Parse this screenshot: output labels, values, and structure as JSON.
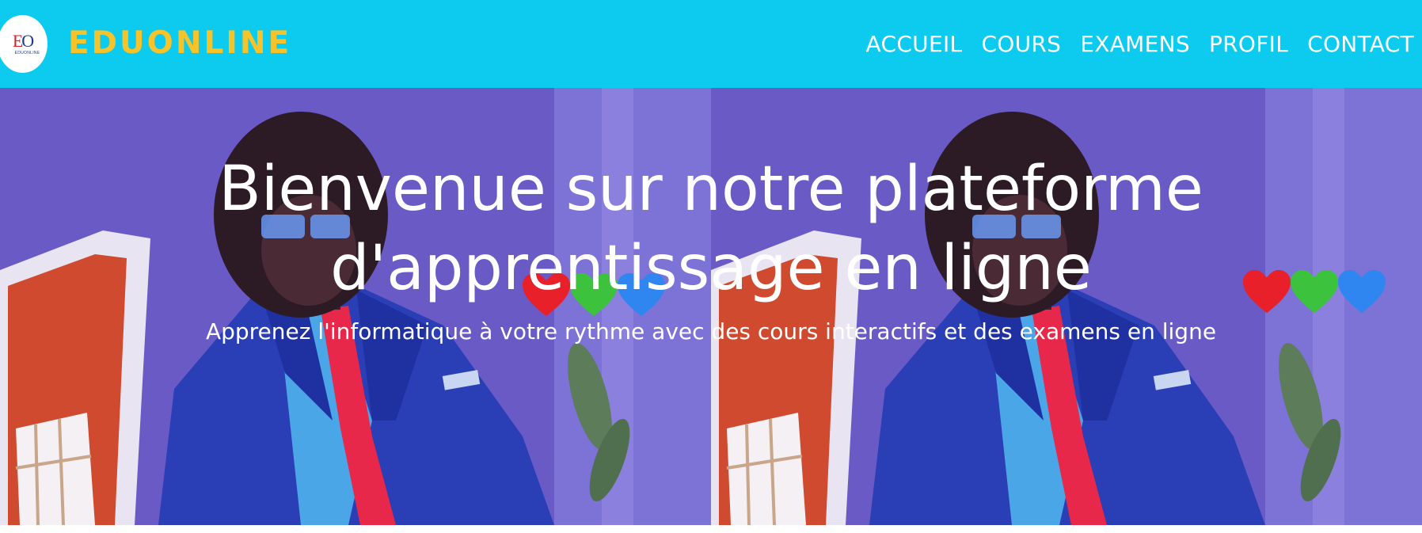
{
  "header": {
    "logo_mark_e": "E",
    "logo_mark_o": "O",
    "logo_sub": "EDUONLINE",
    "brand": "EDUONLINE",
    "nav": [
      {
        "label": "ACCUEIL"
      },
      {
        "label": "COURS"
      },
      {
        "label": "EXAMENS"
      },
      {
        "label": "PROFIL"
      },
      {
        "label": "CONTACT"
      }
    ]
  },
  "hero": {
    "title": "Bienvenue sur notre plateforme d'apprentissage en ligne",
    "subtitle": "Apprenez l'informatique à votre rythme avec des cours interactifs et des examens en ligne"
  },
  "colors": {
    "header_bg": "#0ccbee",
    "brand": "#f6c42a",
    "nav_text": "#ffffff",
    "hero_text": "#ffffff",
    "heart_red": "#e8202a",
    "heart_green": "#3cc23c",
    "heart_blue": "#2f86f0"
  },
  "icons": [
    "logo-icon",
    "red-heart-icon",
    "green-heart-icon",
    "blue-heart-icon"
  ]
}
